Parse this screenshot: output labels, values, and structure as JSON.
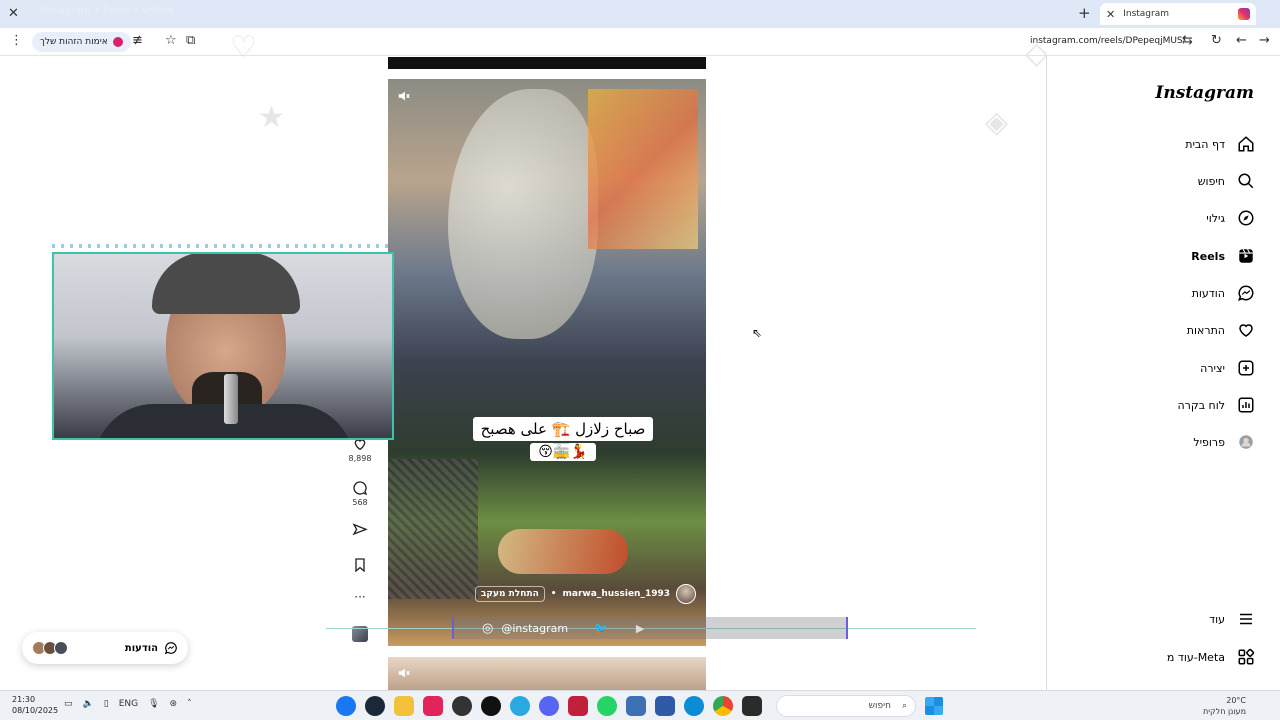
{
  "browser": {
    "tab_title": "Instagram",
    "ghost_tab_text": "Instagram • Reels • videos",
    "url": "instagram.com/reels/DPepeqjMUS/",
    "pill_label": "אימות הזהות שלך"
  },
  "sidebar": {
    "brand": "Instagram",
    "items": [
      {
        "label": "דף הבית",
        "icon": "home-icon"
      },
      {
        "label": "חיפוש",
        "icon": "search-icon"
      },
      {
        "label": "גילוי",
        "icon": "compass-icon"
      },
      {
        "label": "Reels",
        "icon": "reels-icon"
      },
      {
        "label": "הודעות",
        "icon": "messenger-icon"
      },
      {
        "label": "התראות",
        "icon": "heart-icon"
      },
      {
        "label": "יצירה",
        "icon": "plus-square-icon"
      },
      {
        "label": "לוח בקרה",
        "icon": "dashboard-icon"
      },
      {
        "label": "פרופיל",
        "icon": "avatar"
      },
      {
        "label": "עוד",
        "icon": "menu-icon"
      },
      {
        "label": "עוד מ-Meta",
        "icon": "grid-icon"
      }
    ]
  },
  "reel": {
    "caption_line1": "صباح زلازل 🏗️ على هصبح",
    "caption_line2": "😚🚋💃",
    "username": "marwa_hussien_1993",
    "follow_label": "התחלת מעקב",
    "likes": "8,898",
    "comments": "568"
  },
  "stream_overlay": {
    "handle": "@instagram"
  },
  "messages_button": {
    "label": "הודעות"
  },
  "taskbar": {
    "time": "21:30",
    "date": "08/10/2025",
    "lang": "ENG",
    "search_placeholder": "חיפוש",
    "weather_line1": "20°C",
    "weather_line2": "מעונן חלקית"
  }
}
